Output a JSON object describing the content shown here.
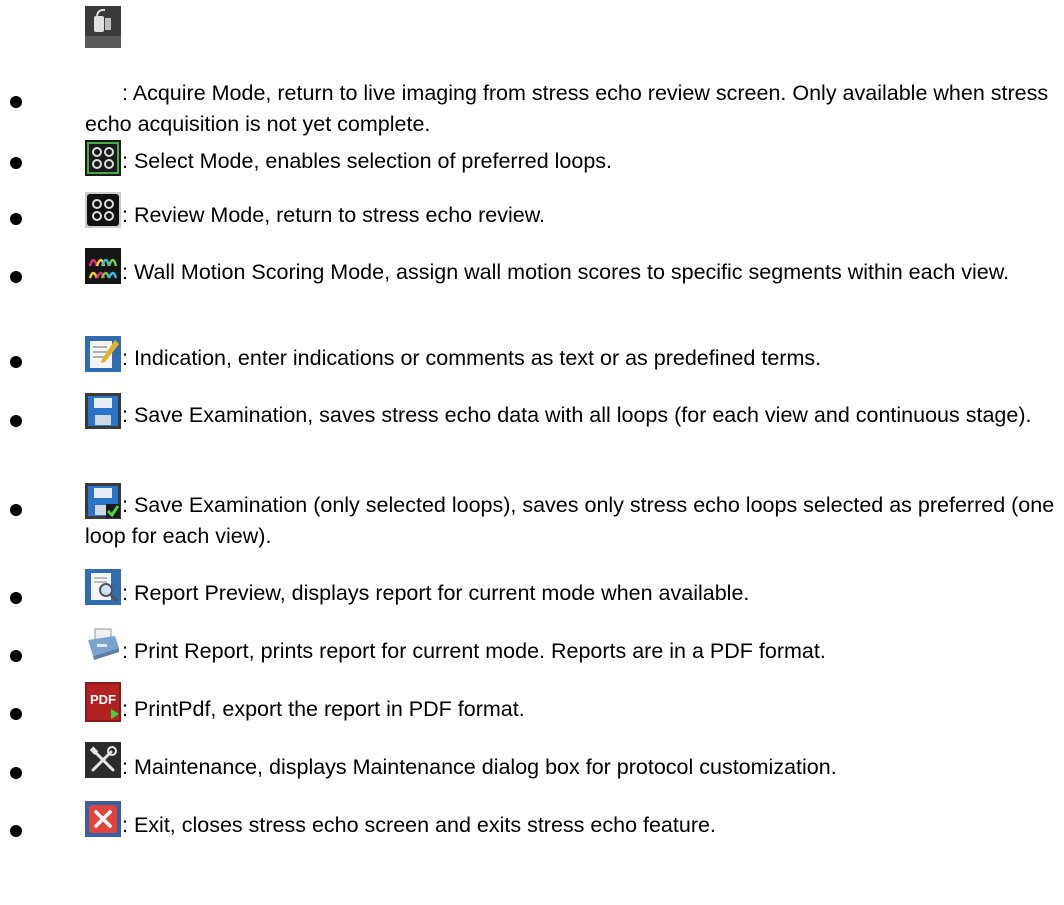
{
  "items": [
    {
      "icon": "acquire-mode-icon",
      "text": ": Acquire Mode, return to live imaging from stress echo review screen. Only available when stress echo acquisition is not yet complete."
    },
    {
      "icon": "select-mode-icon",
      "text": ": Select Mode, enables selection of preferred loops."
    },
    {
      "icon": "review-mode-icon",
      "text": ": Review Mode, return to stress echo review."
    },
    {
      "icon": "wall-motion-scoring-icon",
      "text": ": Wall Motion Scoring Mode, assign wall motion scores to specific segments within each view."
    },
    {
      "icon": "indication-icon",
      "text": ": Indication, enter indications or comments as text or as predefined terms."
    },
    {
      "icon": "save-examination-icon",
      "text": ": Save Examination, saves stress echo data with all loops (for each view and continuous stage)."
    },
    {
      "icon": "save-selected-loops-icon",
      "text": ": Save Examination (only selected loops), saves only stress echo loops selected as preferred (one loop for each view)."
    },
    {
      "icon": "report-preview-icon",
      "text": ": Report Preview, displays report for current mode when available."
    },
    {
      "icon": "print-report-icon",
      "text": ": Print Report, prints report for current mode. Reports are in a PDF format."
    },
    {
      "icon": "print-pdf-icon",
      "text": ": PrintPdf, export the report in PDF format.",
      "icon_label": "PDF"
    },
    {
      "icon": "maintenance-icon",
      "text": ": Maintenance, displays Maintenance dialog box for protocol customization."
    },
    {
      "icon": "exit-icon",
      "text": ": Exit, closes stress echo screen and exits stress echo feature."
    }
  ]
}
